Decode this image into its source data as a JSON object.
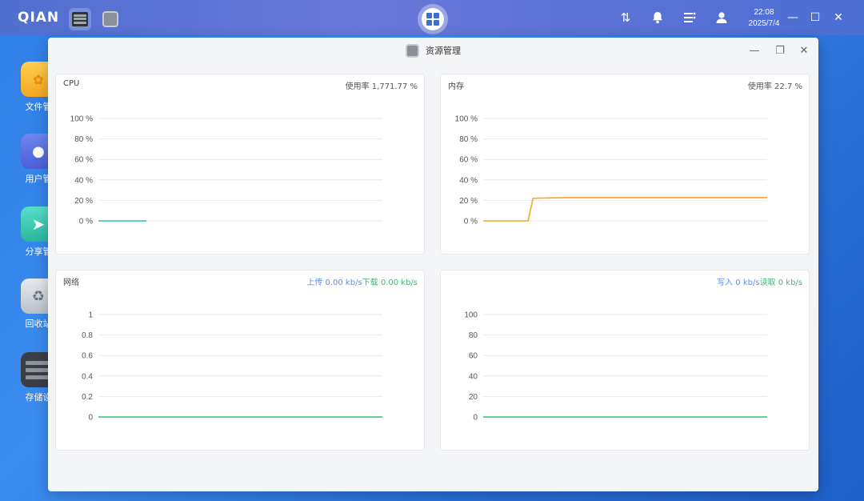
{
  "topbar": {
    "logo": "QIAN",
    "time": "22:08",
    "date": "2025/7/4",
    "icons": [
      "transfer-icon",
      "bell-icon",
      "list-settings-icon",
      "user-icon"
    ]
  },
  "desktop": {
    "items": [
      {
        "label": "文件管",
        "icon": "folder-icon"
      },
      {
        "label": "用户管",
        "icon": "user-manage-icon"
      },
      {
        "label": "分享管",
        "icon": "share-icon"
      },
      {
        "label": "回收站",
        "icon": "recycle-bin-icon"
      },
      {
        "label": "存储设",
        "icon": "storage-icon"
      }
    ]
  },
  "window": {
    "title": "资源管理"
  },
  "panels": {
    "cpu": {
      "title": "CPU",
      "stat_label": "使用率 1,771.77 %",
      "ticks": [
        "100 %",
        "80 %",
        "60 %",
        "40 %",
        "20 %",
        "0 %"
      ],
      "line_color": "#2fbfa8"
    },
    "memory": {
      "title": "内存",
      "stat_label": "使用率 22.7 %",
      "ticks": [
        "100 %",
        "80 %",
        "60 %",
        "40 %",
        "20 %",
        "0 %"
      ],
      "line_color": "#f5a623"
    },
    "network": {
      "title": "网络",
      "upload_label": "上传 0.00 kb/s",
      "download_label": "下载 0.00 kb/s",
      "ticks": [
        "1",
        "0.8",
        "0.6",
        "0.4",
        "0.2",
        "0"
      ],
      "line_color": "#3dbb73",
      "upload_color": "#5b8def",
      "download_color": "#3dbb73"
    },
    "disk": {
      "write_label": "写入 0 kb/s",
      "read_label": "读取 0 kb/s",
      "ticks": [
        "100",
        "80",
        "60",
        "40",
        "20",
        "0"
      ],
      "line_color": "#3dbb73"
    }
  },
  "chart_data": [
    {
      "type": "line",
      "title": "CPU",
      "ylim": [
        0,
        100
      ],
      "series": [
        {
          "values": [
            0,
            0,
            0,
            0,
            0
          ]
        }
      ]
    },
    {
      "type": "line",
      "title": "内存",
      "ylim": [
        0,
        100
      ],
      "series": [
        {
          "values": [
            0,
            0,
            0,
            0,
            0,
            0,
            0,
            0,
            0,
            0,
            22,
            22.2,
            22.3,
            22.4,
            22.5,
            22.6,
            22.6,
            22.7,
            22.7,
            22.7,
            22.7,
            22.7,
            22.7,
            22.7,
            22.7,
            22.7,
            22.7,
            22.7,
            22.7,
            22.7,
            22.7,
            22.7,
            22.7,
            22.7,
            22.7,
            22.7,
            22.7,
            22.7,
            22.7,
            22.7,
            22.7,
            22.7,
            22.7,
            22.7,
            22.7,
            22.7,
            22.7,
            22.7,
            22.7,
            22.7,
            22.7,
            22.7,
            22.7,
            22.7,
            22.7,
            22.7,
            22.7,
            22.7
          ]
        }
      ]
    },
    {
      "type": "line",
      "title": "网络",
      "ylim": [
        0,
        1
      ],
      "series": [
        {
          "values": [
            0,
            0,
            0,
            0,
            0,
            0,
            0,
            0,
            0,
            0
          ]
        }
      ]
    },
    {
      "type": "line",
      "ylim": [
        0,
        100
      ],
      "series": [
        {
          "values": [
            0,
            0,
            0,
            0,
            0,
            0,
            0,
            0,
            0,
            0
          ]
        }
      ]
    }
  ]
}
